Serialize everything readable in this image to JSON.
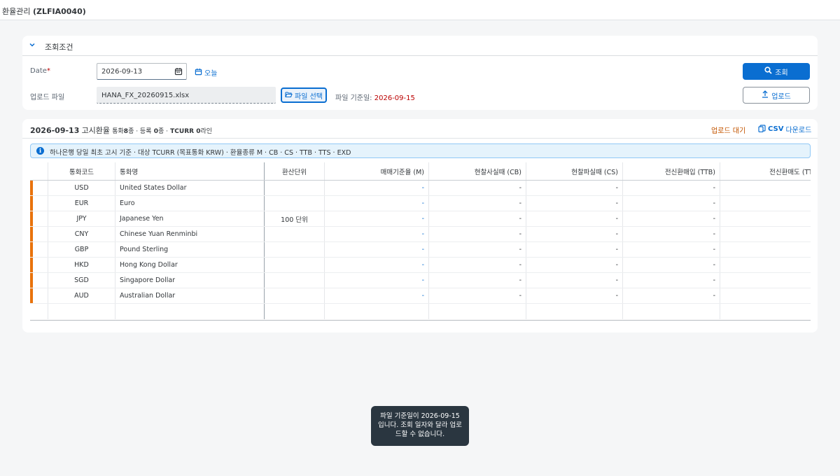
{
  "app": {
    "title": "환율관리",
    "code": "(ZLFIA0040)"
  },
  "conditions": {
    "title": "조회조건",
    "date_label": "Date",
    "required_mark": "*",
    "date_value": "2026-09-13",
    "today_label": "오늘",
    "upload_label": "업로드 파일",
    "file_value": "HANA_FX_20260915.xlsx",
    "file_button": "파일 선택",
    "file_date_label": "파일 기준일:",
    "file_date_value": "2026-09-15",
    "search_button": "조회",
    "upload_button": "업로드"
  },
  "result": {
    "date": "2026-09-13",
    "title": "고시환율",
    "summary_currency_label": "통화",
    "summary_currency_count": "8",
    "summary_currency_unit": "종 · 등록",
    "summary_reg_count": "0",
    "summary_reg_unit": "종 ·",
    "summary_tcurr": "TCURR",
    "summary_tcurr_count": "0",
    "summary_tcurr_unit": "라인",
    "pending_label": "업로드 대기",
    "csv_label": "CSV",
    "csv_suffix": "다운로드",
    "info": "하나은행 당일 최초 고시 기준 · 대상 TCURR (목표통화 KRW) · 환율종류 M · CB · CS · TTB · TTS · EXD"
  },
  "table": {
    "headers": {
      "code": "통화코드",
      "name": "통화명",
      "unit": "환산단위",
      "m": "매매기준율 (M)",
      "cb": "현찰사실때 (CB)",
      "cs": "현찰파실때 (CS)",
      "ttb": "전신환매입 (TTB)",
      "tts": "전신환매도 (TTS"
    },
    "rows": [
      {
        "code": "USD",
        "name": "United States Dollar",
        "unit": "",
        "m": "-",
        "cb": "-",
        "cs": "-",
        "ttb": "-"
      },
      {
        "code": "EUR",
        "name": "Euro",
        "unit": "",
        "m": "-",
        "cb": "-",
        "cs": "-",
        "ttb": "-"
      },
      {
        "code": "JPY",
        "name": "Japanese Yen",
        "unit": "100 단위",
        "m": "-",
        "cb": "-",
        "cs": "-",
        "ttb": "-"
      },
      {
        "code": "CNY",
        "name": "Chinese Yuan Renminbi",
        "unit": "",
        "m": "-",
        "cb": "-",
        "cs": "-",
        "ttb": "-"
      },
      {
        "code": "GBP",
        "name": "Pound Sterling",
        "unit": "",
        "m": "-",
        "cb": "-",
        "cs": "-",
        "ttb": "-"
      },
      {
        "code": "HKD",
        "name": "Hong Kong Dollar",
        "unit": "",
        "m": "-",
        "cb": "-",
        "cs": "-",
        "ttb": "-"
      },
      {
        "code": "SGD",
        "name": "Singapore Dollar",
        "unit": "",
        "m": "-",
        "cb": "-",
        "cs": "-",
        "ttb": "-"
      },
      {
        "code": "AUD",
        "name": "Australian Dollar",
        "unit": "",
        "m": "-",
        "cb": "-",
        "cs": "-",
        "ttb": "-"
      }
    ]
  },
  "toast": {
    "message": "파일 기준일이 2026-09-15 입니다. 조회 일자와 달라 업로드할 수 없습니다."
  },
  "colors": {
    "accent": "#0a6ed1",
    "marker": "#e9730c",
    "error": "#bb0000",
    "toast_bg": "#2a3640"
  }
}
